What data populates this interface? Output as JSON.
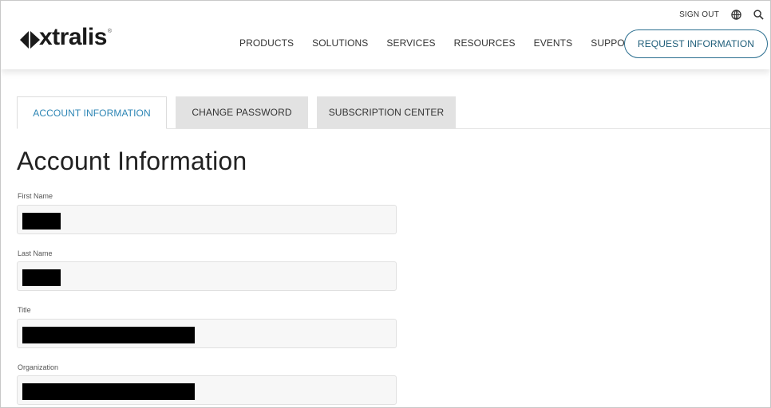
{
  "brand": {
    "name": "xtralis",
    "trademark": "®",
    "logo_color": "#1a1a1a"
  },
  "utility": {
    "sign_out_label": "SIGN OUT",
    "globe_icon": "globe-icon",
    "search_icon": "search-icon"
  },
  "nav": {
    "items": [
      {
        "label": "PRODUCTS"
      },
      {
        "label": "SOLUTIONS"
      },
      {
        "label": "SERVICES"
      },
      {
        "label": "RESOURCES"
      },
      {
        "label": "EVENTS"
      },
      {
        "label": "SUPPORT"
      }
    ],
    "request_button_label": "REQUEST INFORMATION"
  },
  "tabs": [
    {
      "label": "ACCOUNT INFORMATION",
      "active": true
    },
    {
      "label": "CHANGE PASSWORD",
      "active": false
    },
    {
      "label": "SUBSCRIPTION CENTER",
      "active": false
    }
  ],
  "main": {
    "title": "Account Information",
    "fields": [
      {
        "label": "First Name",
        "value_redacted": true
      },
      {
        "label": "Last Name",
        "value_redacted": true
      },
      {
        "label": "Title",
        "value_redacted": true
      },
      {
        "label": "Organization",
        "value_redacted": true
      }
    ]
  },
  "colors": {
    "accent": "#2e86b5",
    "button_border": "#2a6e8f",
    "inactive_tab": "#e2e2e2",
    "input_background": "#f7f7f7",
    "redaction": "#000000"
  }
}
